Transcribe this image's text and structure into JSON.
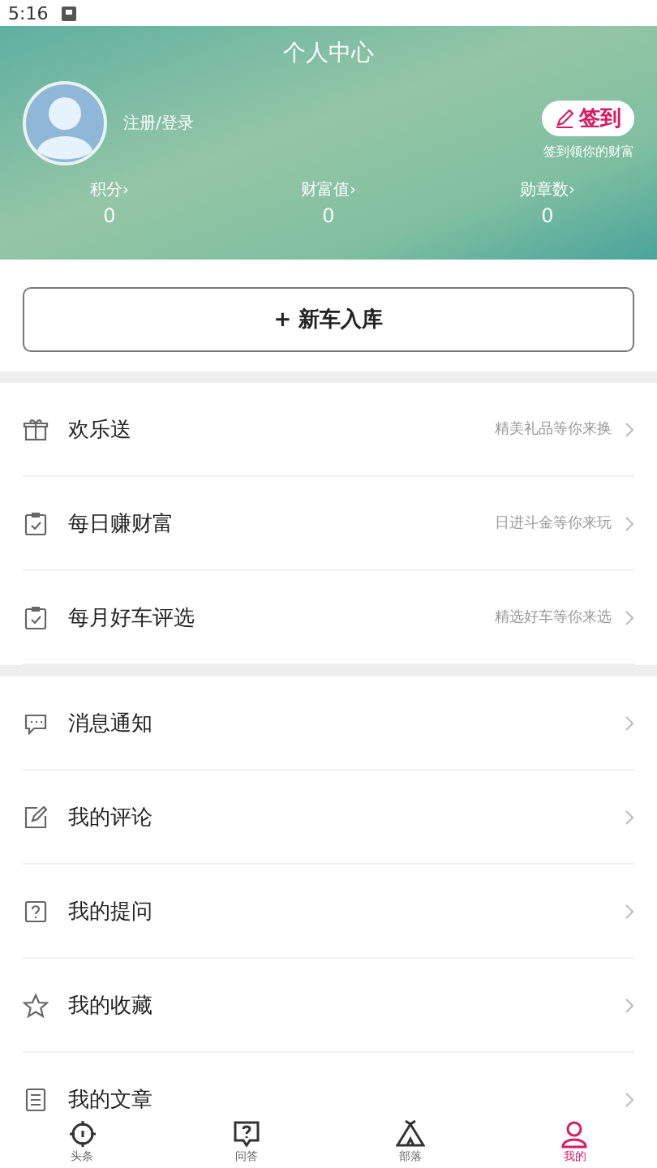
{
  "status_bar": {
    "time": "5:16"
  },
  "header": {
    "title": "个人中心",
    "login": "注册/登录",
    "sign_in": {
      "label": "签到",
      "hint": "签到领你的财富"
    },
    "stats": [
      {
        "label": "积分›",
        "value": "0"
      },
      {
        "label": "财富值›",
        "value": "0"
      },
      {
        "label": "勋章数›",
        "value": "0"
      }
    ]
  },
  "add_car_button": "+ 新车入库",
  "sections": [
    {
      "items": [
        {
          "label": "欢乐送",
          "subtitle": "精美礼品等你来换"
        },
        {
          "label": "每日赚财富",
          "subtitle": "日进斗金等你来玩"
        },
        {
          "label": "每月好车评选",
          "subtitle": "精选好车等你来选"
        }
      ]
    },
    {
      "items": [
        {
          "label": "消息通知"
        },
        {
          "label": "我的评论"
        },
        {
          "label": "我的提问"
        },
        {
          "label": "我的收藏"
        },
        {
          "label": "我的文章"
        }
      ]
    }
  ],
  "tab_bar": [
    {
      "label": "头条",
      "selected": false
    },
    {
      "label": "问答",
      "selected": false
    },
    {
      "label": "部落",
      "selected": false
    },
    {
      "label": "我的",
      "selected": true
    }
  ]
}
